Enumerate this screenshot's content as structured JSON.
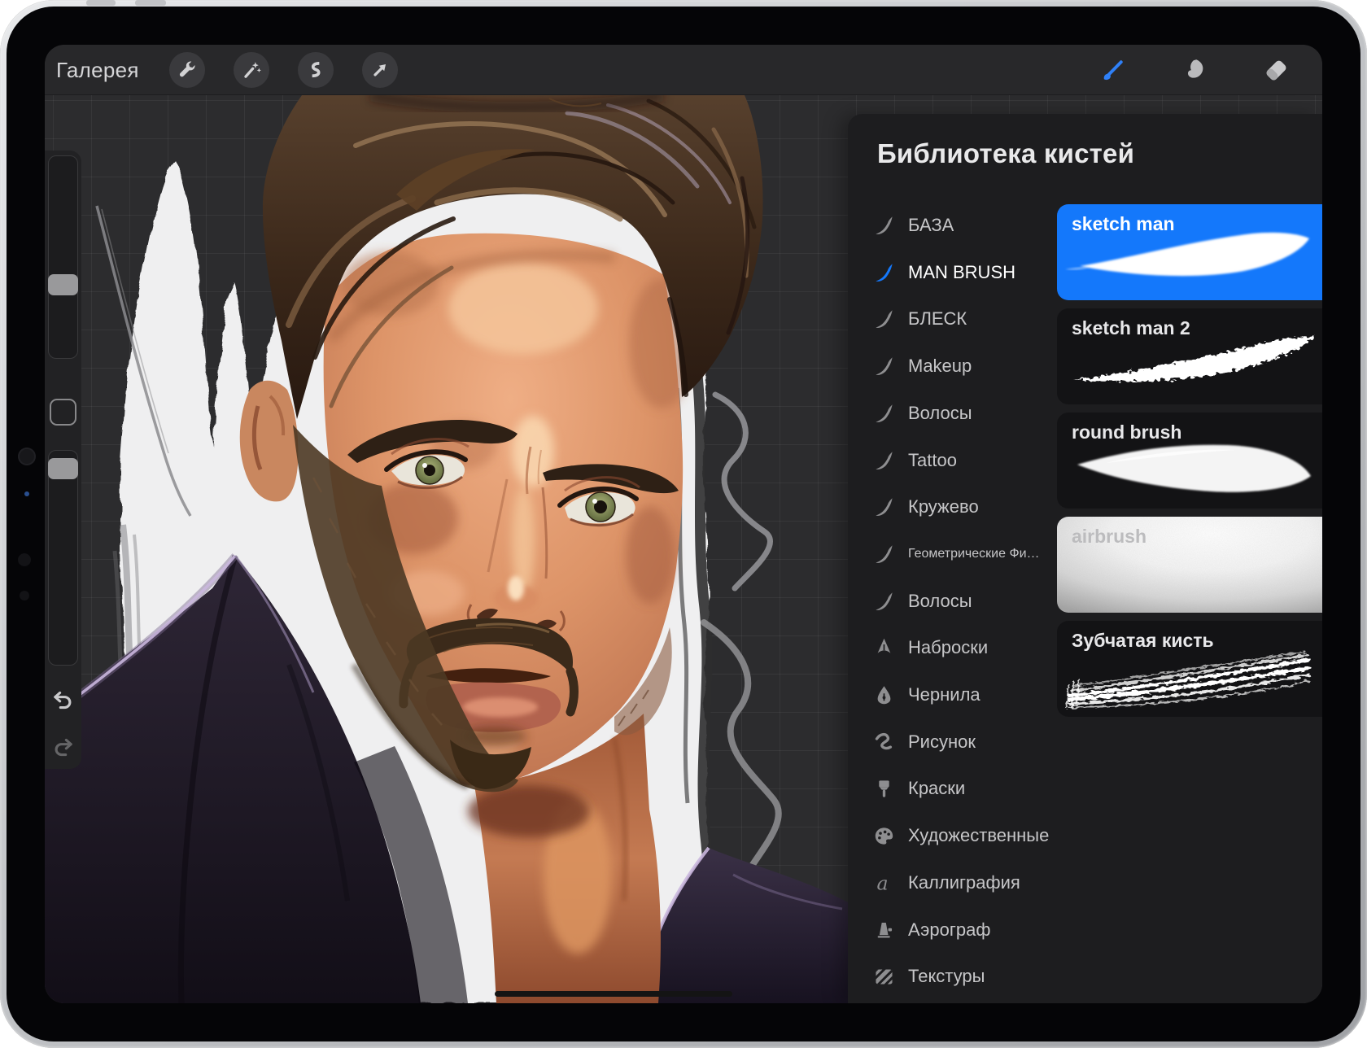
{
  "toolbar": {
    "gallery_label": "Галерея",
    "left_icons": [
      "wrench-icon",
      "magic-wand-icon",
      "selection-s-icon",
      "transform-arrow-icon"
    ],
    "right_icons": [
      "paint-brush-icon",
      "smudge-finger-icon",
      "eraser-icon"
    ],
    "active_tool": "paint-brush",
    "accent_color": "#1478fb"
  },
  "sidebar": {
    "controls": [
      "brush-size-slider",
      "modify-button",
      "opacity-slider",
      "undo-button",
      "redo-button"
    ]
  },
  "brush_panel": {
    "title": "Библиотека кистей",
    "accent_color": "#1478fb",
    "categories": [
      {
        "label": "БАЗА",
        "icon": "swoosh-icon",
        "selected": false
      },
      {
        "label": "MAN BRUSH",
        "icon": "swoosh-icon",
        "selected": true
      },
      {
        "label": "БЛЕСК",
        "icon": "swoosh-icon",
        "selected": false
      },
      {
        "label": "Makeup",
        "icon": "swoosh-icon",
        "selected": false
      },
      {
        "label": "Волосы",
        "icon": "swoosh-icon",
        "selected": false
      },
      {
        "label": "Tattoo",
        "icon": "swoosh-icon",
        "selected": false
      },
      {
        "label": "Кружево",
        "icon": "swoosh-icon",
        "selected": false
      },
      {
        "label": "Геометрические Фи…",
        "icon": "swoosh-icon",
        "selected": false,
        "small_text": true
      },
      {
        "label": "Волосы",
        "icon": "swoosh-icon",
        "selected": false
      },
      {
        "label": "Наброски",
        "icon": "pencil-icon",
        "selected": false
      },
      {
        "label": "Чернила",
        "icon": "ink-nib-icon",
        "selected": false
      },
      {
        "label": "Рисунок",
        "icon": "scribble-icon",
        "selected": false
      },
      {
        "label": "Краски",
        "icon": "flat-brush-icon",
        "selected": false
      },
      {
        "label": "Художественные",
        "icon": "palette-icon",
        "selected": false
      },
      {
        "label": "Каллиграфия",
        "icon": "calligraphy-a-icon",
        "selected": false
      },
      {
        "label": "Аэрограф",
        "icon": "airbrush-icon",
        "selected": false
      },
      {
        "label": "Текстуры",
        "icon": "texture-icon",
        "selected": false
      }
    ],
    "brushes": [
      {
        "name": "sketch man",
        "selected": true
      },
      {
        "name": "sketch man 2",
        "selected": false
      },
      {
        "name": "round brush",
        "selected": false
      },
      {
        "name": "airbrush",
        "selected": false
      },
      {
        "name": "Зубчатая кисть",
        "selected": false
      }
    ]
  },
  "canvas": {
    "content": "digital portrait painting of a man",
    "colors": {
      "workspace_background": "#2c2c2e",
      "canvas_white": "#efeff0",
      "hair_brown": "#3a2719",
      "skin": "#dd9468",
      "coat_dark": "#201a28",
      "coat_rim_light": "#c9b6dd"
    }
  }
}
